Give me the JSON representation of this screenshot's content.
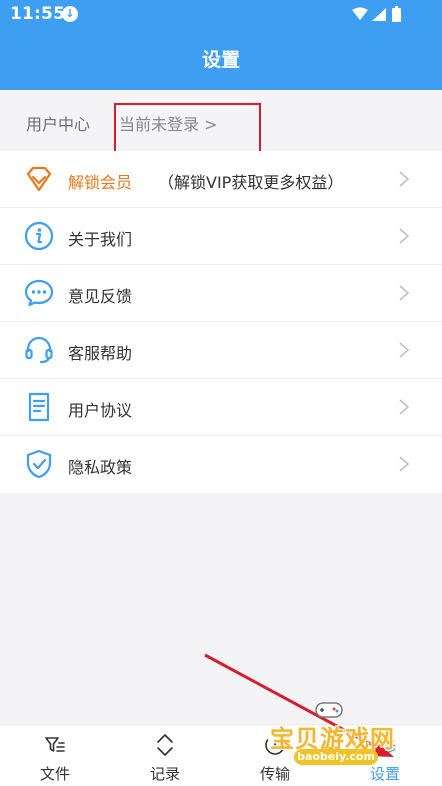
{
  "status_bar": {
    "time": "11:55"
  },
  "header": {
    "title": "设置"
  },
  "user_center": {
    "label": "用户中心",
    "login_text": "当前未登录 >"
  },
  "menu": {
    "items": [
      {
        "label": "解锁会员",
        "hint": "（解锁VIP获取更多权益）",
        "icon": "diamond-icon"
      },
      {
        "label": "关于我们",
        "icon": "info-icon"
      },
      {
        "label": "意见反馈",
        "icon": "chat-bubble-icon"
      },
      {
        "label": "客服帮助",
        "icon": "headset-icon"
      },
      {
        "label": "用户协议",
        "icon": "document-icon"
      },
      {
        "label": "隐私政策",
        "icon": "shield-check-icon"
      }
    ]
  },
  "tabs": [
    {
      "label": "文件",
      "icon": "filter-list-icon"
    },
    {
      "label": "记录",
      "icon": "up-down-chevron-icon"
    },
    {
      "label": "传输",
      "icon": "transfer-icon"
    },
    {
      "label": "设置",
      "icon": "layers-icon",
      "active": true
    }
  ],
  "watermark": {
    "title": "宝贝游戏网",
    "url": "baobeiy.com"
  },
  "colors": {
    "primary": "#3d9ef2",
    "vip": "#e8791e",
    "annotation": "#d81e2a"
  }
}
